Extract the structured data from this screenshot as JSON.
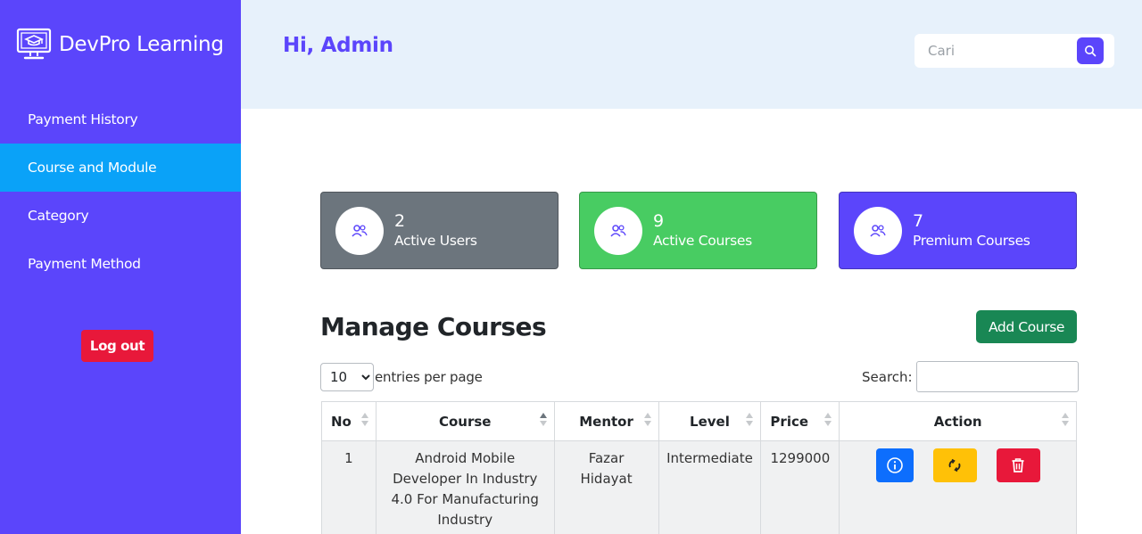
{
  "sidebar": {
    "brand": "DevPro Learning",
    "items": [
      {
        "label": "Payment History"
      },
      {
        "label": "Course and Module"
      },
      {
        "label": "Category"
      },
      {
        "label": "Payment Method"
      }
    ],
    "logout_label": "Log out"
  },
  "header": {
    "greeting": "Hi, Admin",
    "search_placeholder": "Cari"
  },
  "stats": {
    "users": {
      "value": "2",
      "label": "Active Users"
    },
    "courses": {
      "value": "9",
      "label": "Active Courses"
    },
    "premium": {
      "value": "7",
      "label": "Premium Courses"
    }
  },
  "manage": {
    "title": "Manage Courses",
    "add_label": "Add Course",
    "per_page_value": "10",
    "per_page_text": "entries per page",
    "search_label": "Search:"
  },
  "table": {
    "headers": {
      "no": "No",
      "course": "Course",
      "mentor": "Mentor",
      "level": "Level",
      "price": "Price",
      "action": "Action"
    },
    "rows": [
      {
        "no": "1",
        "course": "Android Mobile Developer In Industry 4.0 For Manufacturing Industry",
        "mentor": "Fazar Hidayat",
        "level": "Intermediate",
        "price": "1299000"
      }
    ]
  },
  "colors": {
    "sidebar": "#5b45fb",
    "active_nav": "#0aa2f8",
    "header_bg": "#e7f1fb",
    "users_card": "#6c757d",
    "courses_card": "#48cc62",
    "premium_card": "#5b45fb",
    "add_button": "#198754",
    "logout": "#e8183a"
  },
  "icons": {
    "brand": "monitor-graduation-icon",
    "search": "search-icon",
    "stat": "users-icon",
    "info": "info-icon",
    "edit": "refresh-icon",
    "delete": "trash-icon"
  }
}
